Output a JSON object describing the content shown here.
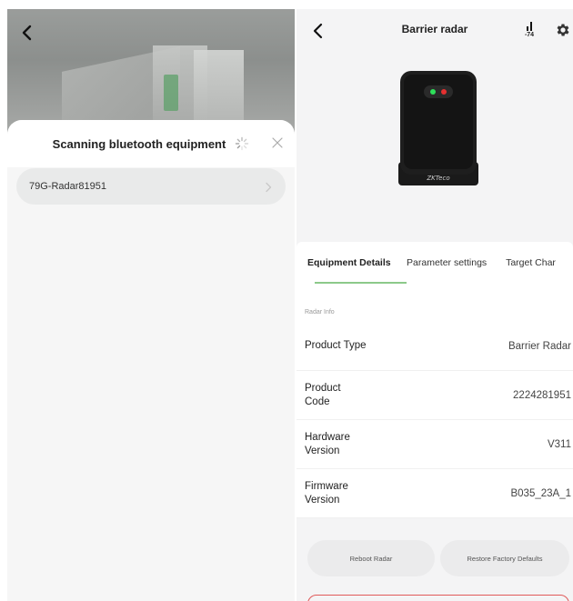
{
  "left": {
    "sheet_title": "Scanning bluetooth equipment",
    "devices": [
      {
        "name": "79G-Radar81951"
      }
    ]
  },
  "right": {
    "title": "Barrier radar",
    "signal_value": "-74",
    "device_brand": "ZKTeco",
    "tabs": [
      {
        "label": "Equipment Details",
        "active": true
      },
      {
        "label": "Parameter settings",
        "active": false
      },
      {
        "label": "Target Char",
        "active": false
      }
    ],
    "section_label": "Radar Info",
    "info": [
      {
        "label": "Product Type",
        "value": "Barrier Radar"
      },
      {
        "label": "Product Code",
        "value": "2224281951"
      },
      {
        "label": "Hardware Version",
        "value": "V311"
      },
      {
        "label": "Firmware Version",
        "value": "B035_23A_1"
      }
    ],
    "buttons": {
      "reboot": "Reboot Radar",
      "restore": "Restore Factory Defaults"
    }
  },
  "colors": {
    "accent": "#8cc98a",
    "danger": "#e05a5a",
    "pill_bg": "#ebebec"
  },
  "icons": [
    "back-icon",
    "spinner-icon",
    "close-icon",
    "chevron-right-icon",
    "signal-icon",
    "gear-icon"
  ]
}
